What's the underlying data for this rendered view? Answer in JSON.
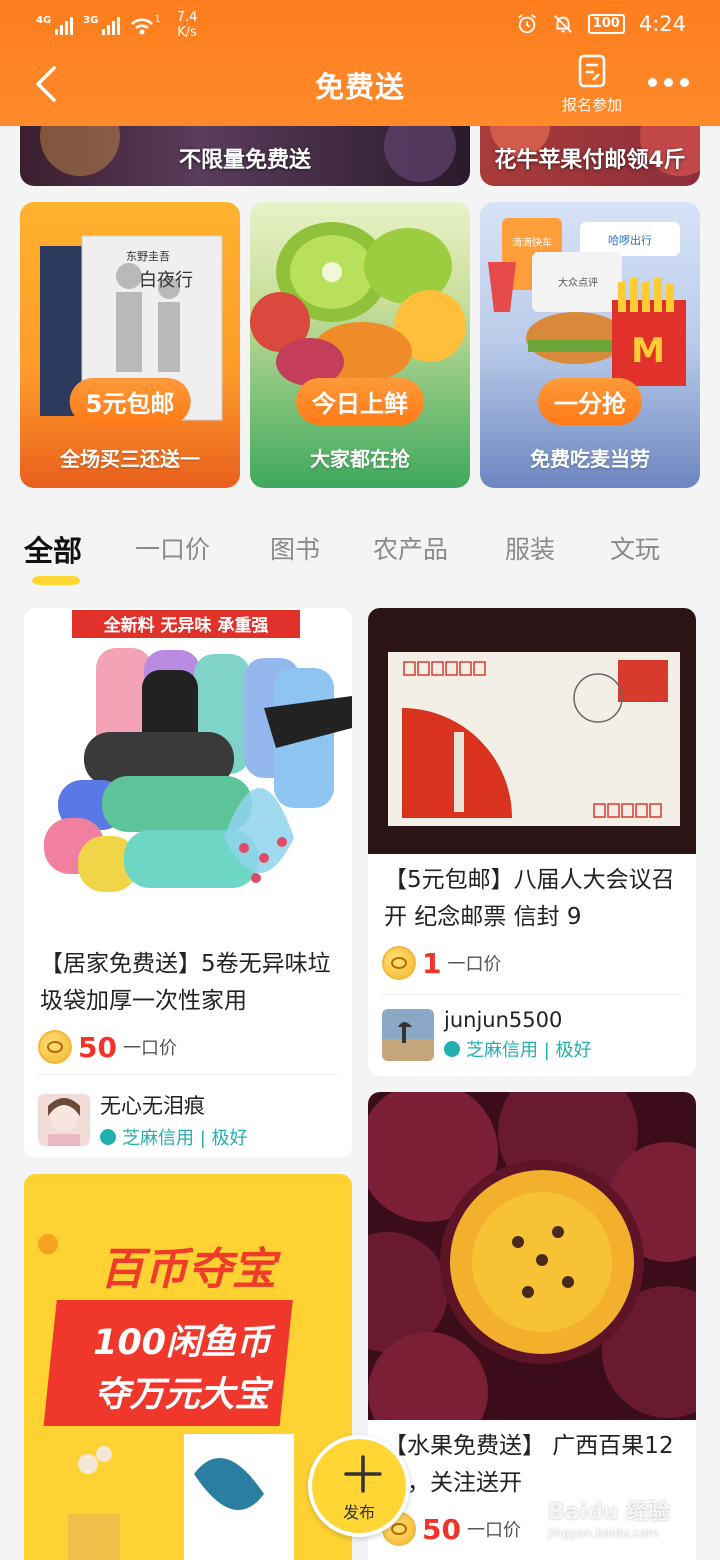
{
  "status_bar": {
    "signal1_label": "4G",
    "signal2_label": "3G",
    "wifi_badge": "1",
    "speed": "7.4",
    "speed_unit": "K/s",
    "battery": "100",
    "time": "4:24"
  },
  "header": {
    "title": "免费送",
    "signup_label": "报名参加"
  },
  "banners": [
    {
      "label": "不限量免费送"
    },
    {
      "label": "花牛苹果付邮领4斤"
    }
  ],
  "promos": [
    {
      "pill": "5元包邮",
      "subtitle": "全场买三还送一",
      "book_author": "东野圭吾",
      "book_title": "白夜行"
    },
    {
      "pill": "今日上鲜",
      "subtitle": "大家都在抢"
    },
    {
      "pill": "一分抢",
      "subtitle": "免费吃麦当劳",
      "brand1": "滴滴快车",
      "brand2": "哈啰出行",
      "brand3": "大众点评"
    }
  ],
  "tabs": [
    {
      "label": "全部",
      "active": true
    },
    {
      "label": "一口价",
      "active": false
    },
    {
      "label": "图书",
      "active": false
    },
    {
      "label": "农产品",
      "active": false
    },
    {
      "label": "服装",
      "active": false
    },
    {
      "label": "文玩",
      "active": false
    }
  ],
  "feed": {
    "card1": {
      "banner_text": "全新料  无异味  承重强",
      "title": "【居家免费送】5卷无异味垃圾袋加厚一次性家用",
      "price": "50",
      "price_unit": "一口价",
      "user": "无心无泪痕",
      "credit": "芝麻信用 | 极好"
    },
    "card2": {
      "title": "【5元包邮】八届人大会议召开 纪念邮票 信封 9",
      "price": "1",
      "price_unit": "一口价",
      "user": "junjun5500",
      "credit": "芝麻信用 | 极好"
    },
    "card3": {
      "line1": "百币夺宝",
      "line2": "100闲鱼币",
      "line3": "夺万元大宝"
    },
    "card4": {
      "title": "【水果免费送】 广西百果12个，关注送开",
      "price": "50",
      "price_unit": "一口价"
    }
  },
  "fab": {
    "label": "发布"
  },
  "watermark": {
    "brand": "Baidu 经验",
    "url": "jingyan.baidu.com"
  }
}
